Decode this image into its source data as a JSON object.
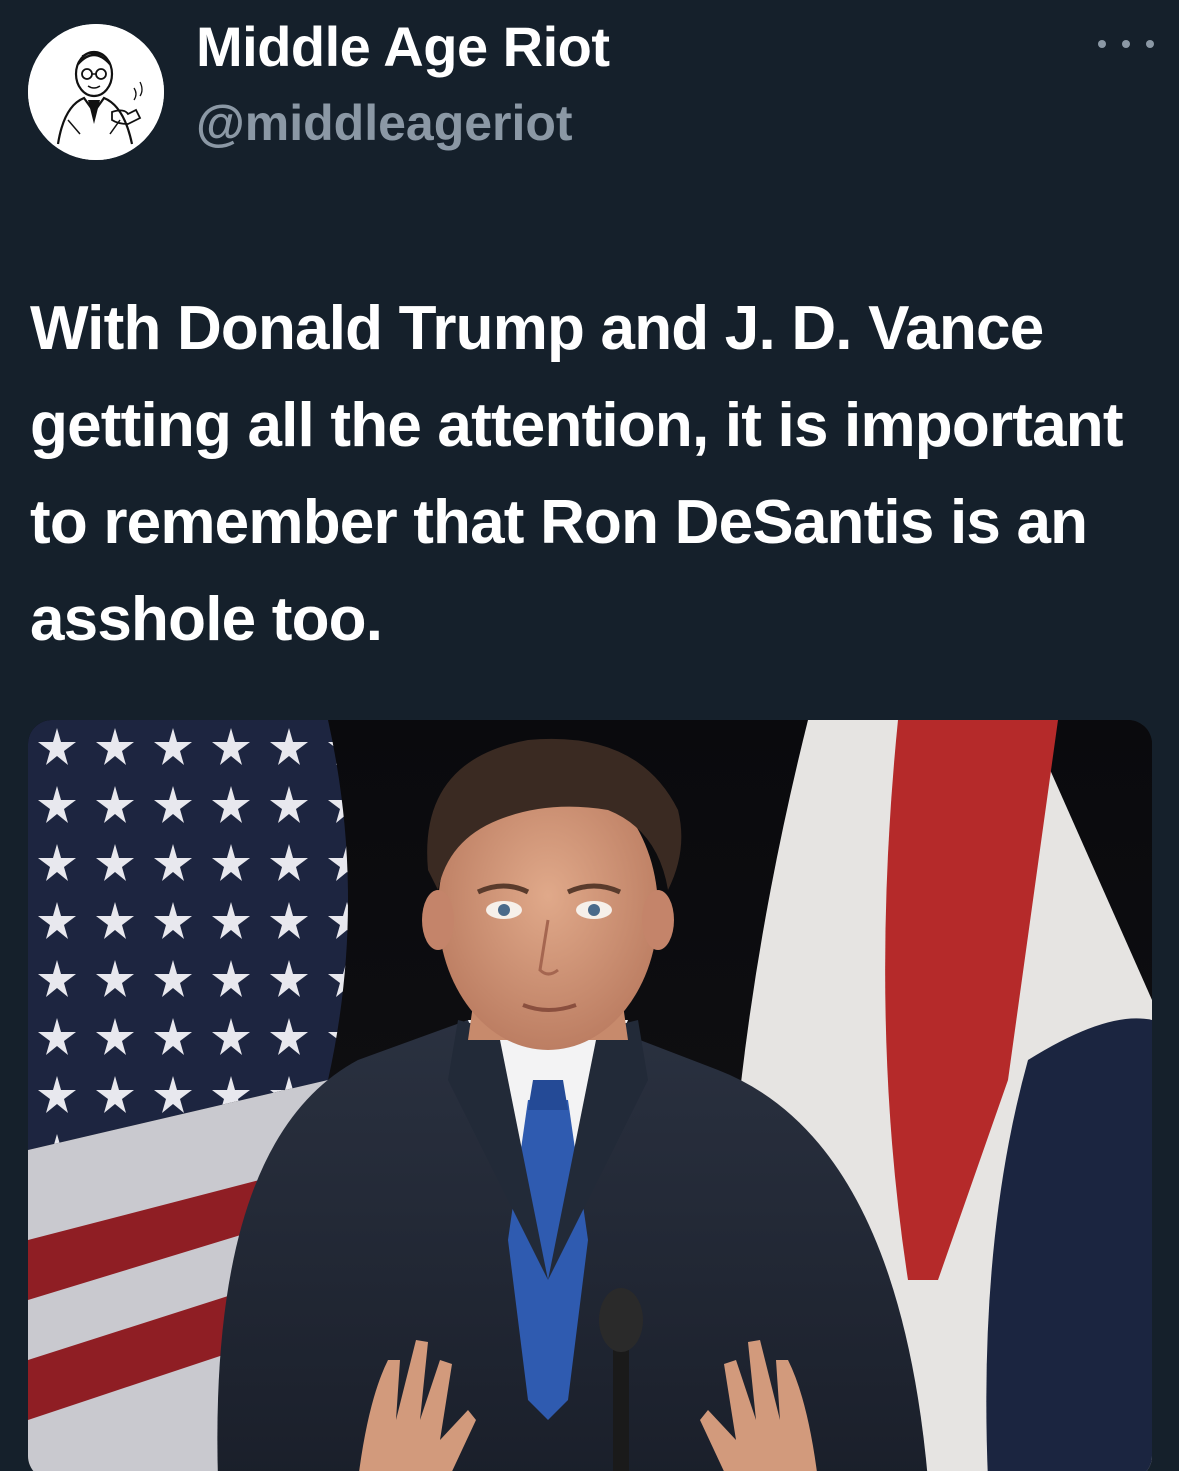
{
  "tweet": {
    "author": {
      "display_name": "Middle Age Riot",
      "handle": "@middleageriot",
      "avatar_icon": "vintage-man-pipe-illustration"
    },
    "more_icon": "ellipsis-icon",
    "text": "With Donald Trump and J. D. Vance getting all the attention, it is important to remember that Ron DeSantis is an asshole too.",
    "media": {
      "type": "photo"
    }
  },
  "colors": {
    "background": "#15202b",
    "primary_text": "#ffffff",
    "secondary_text": "#8b98a5"
  }
}
